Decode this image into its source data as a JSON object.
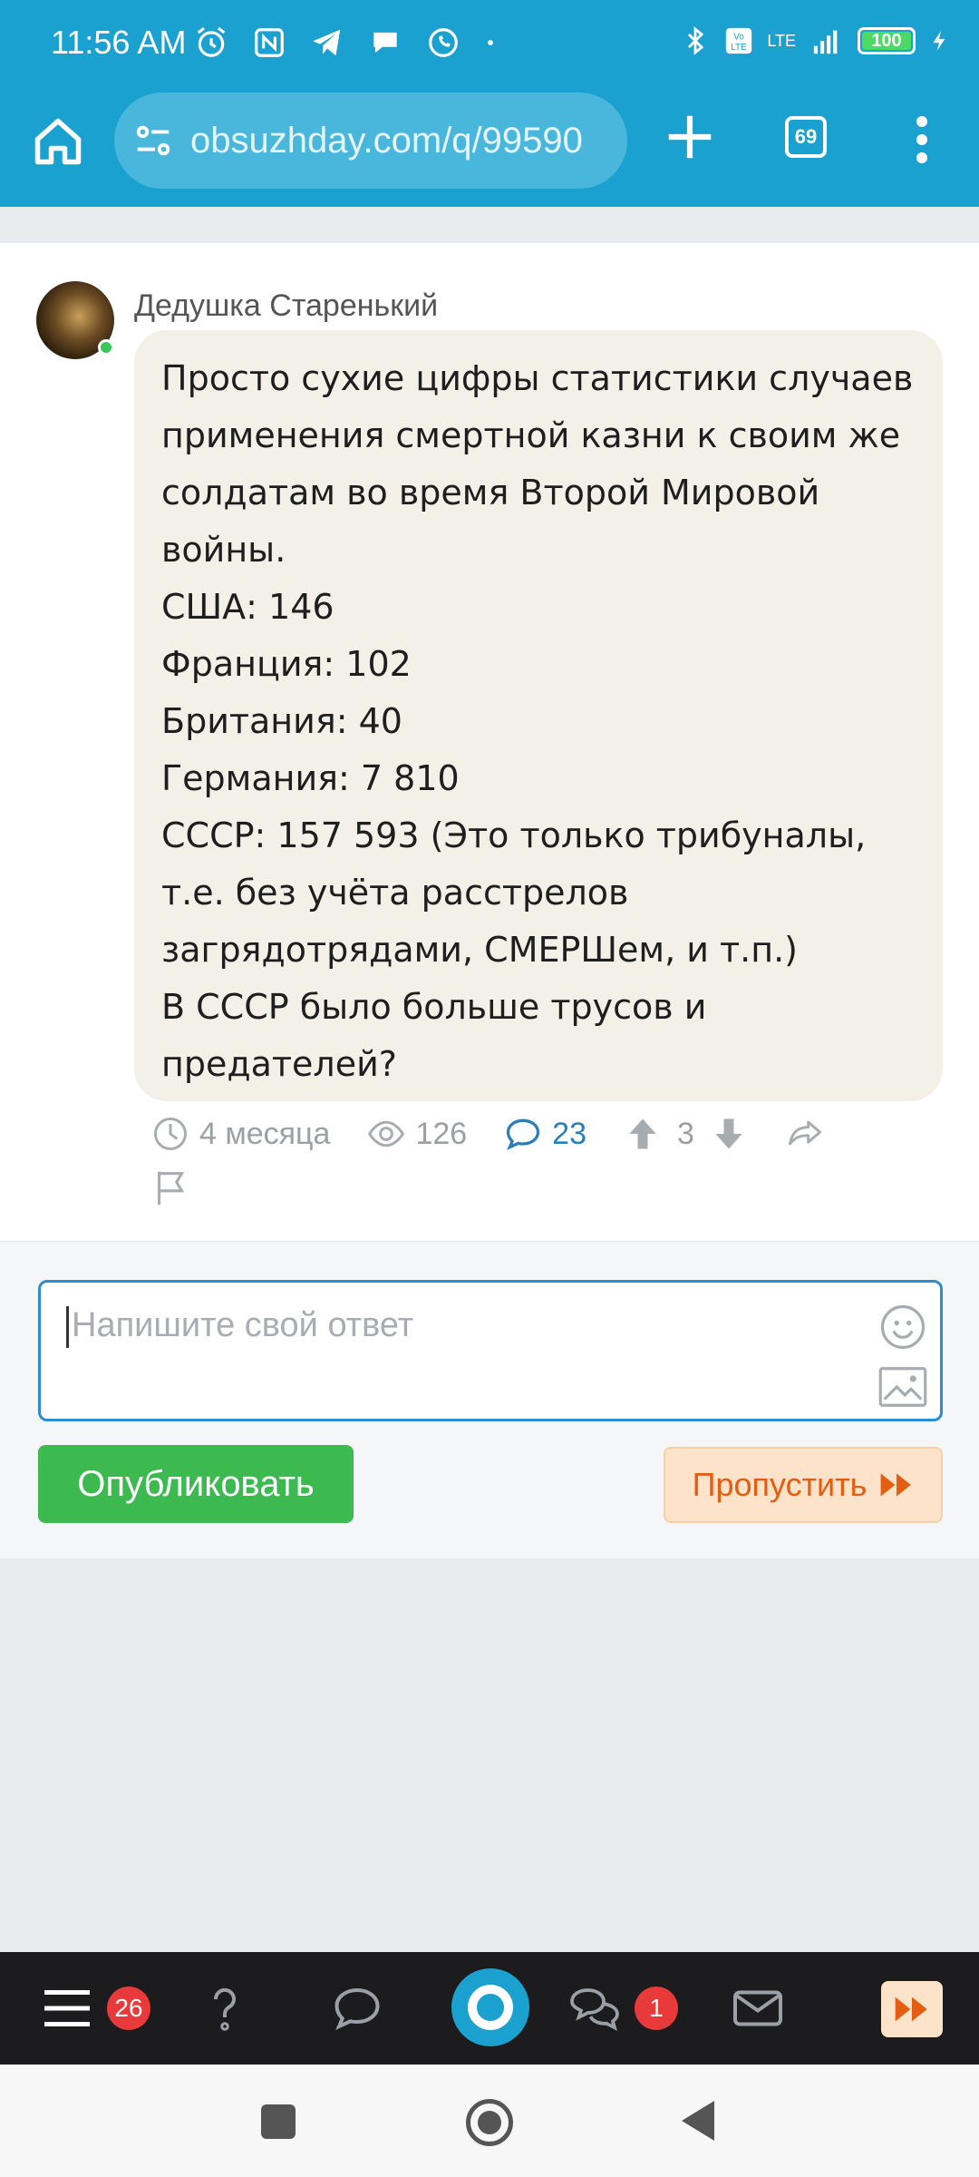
{
  "status_bar": {
    "time": "11:56 AM",
    "battery": "100",
    "network": "LTE"
  },
  "browser": {
    "url": "obsuzhday.com/q/99590",
    "tab_count": "69"
  },
  "post": {
    "author": "Дедушка Старенький",
    "lines": [
      "Просто сухие цифры статистики случаев",
      "применения смертной казни к своим же",
      "солдатам во время Второй Мировой",
      "войны.",
      "США: 146",
      "Франция: 102",
      "Британия: 40",
      "Германия: 7 810",
      "СССР: 157 593 (Это только трибуналы,",
      "т.е. без учёта расстрелов",
      "загрядотрядами, СМЕРШем, и т.п.)",
      "В СССР было больше трусов и",
      "предателей?"
    ],
    "time_ago": "4 месяца",
    "views": "126",
    "comments": "23",
    "rating": "3"
  },
  "reply": {
    "placeholder": "Напишите свой ответ",
    "publish_label": "Опубликовать",
    "skip_label": "Пропустить"
  },
  "bottom_nav": {
    "menu_badge": "26",
    "messages_badge": "1"
  },
  "colors": {
    "brand": "#1ba1cf",
    "publish": "#3cba50",
    "skip_bg": "#fde3c9",
    "skip_text": "#e45e12"
  }
}
